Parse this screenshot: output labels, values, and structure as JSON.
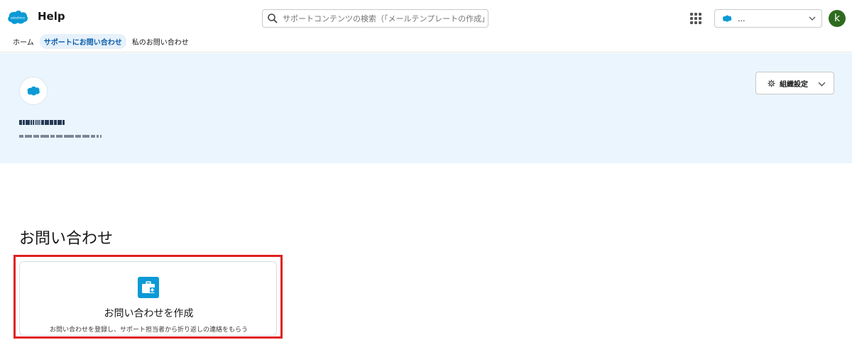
{
  "header": {
    "app_title": "Help",
    "search_placeholder": "サポートコンテンツの検索（「メールテンプレートの作成」...",
    "org_selector_text": "...",
    "avatar_initial": "k"
  },
  "nav": {
    "tabs": [
      {
        "label": "ホーム",
        "active": false
      },
      {
        "label": "サポートにお問い合わせ",
        "active": true
      },
      {
        "label": "私のお問い合わせ",
        "active": false
      }
    ]
  },
  "banner": {
    "settings_label": "組織設定"
  },
  "main": {
    "section_title": "お問い合わせ",
    "card": {
      "title": "お問い合わせを作成",
      "description": "お問い合わせを登録し、サポート担当者から折り返しの連絡をもらう"
    }
  },
  "colors": {
    "brand": "#0b9ad6",
    "banner_bg": "#eaf5fe",
    "active_tab_text": "#0b5cab",
    "highlight": "#e02020",
    "avatar_bg": "#2e6b1f"
  },
  "icons": {
    "logo": "salesforce-cloud-logo",
    "search": "search-icon",
    "apps": "app-launcher-icon",
    "settings": "gear-icon",
    "case": "case-briefcase-icon"
  }
}
